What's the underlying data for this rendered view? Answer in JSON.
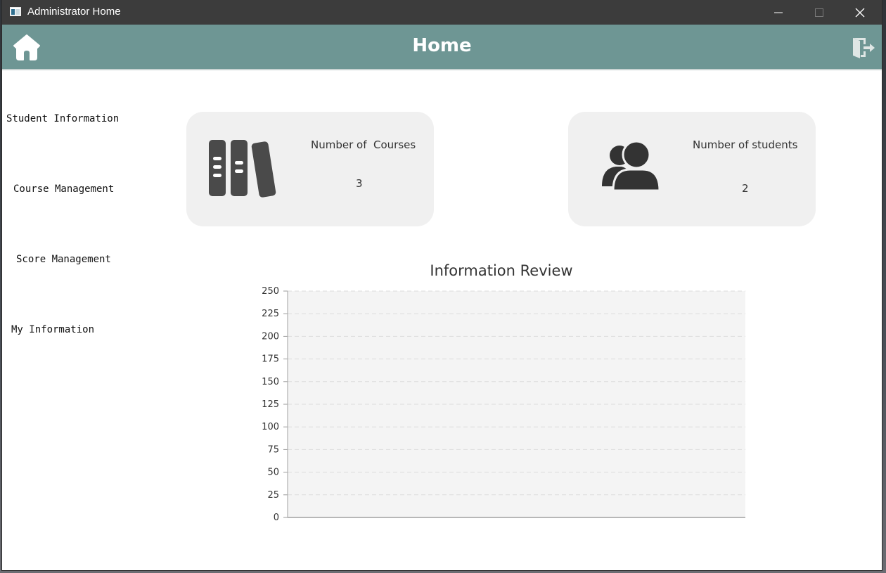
{
  "window": {
    "title": "Administrator Home"
  },
  "header": {
    "title": "Home",
    "home_icon": "home-icon",
    "logout_icon": "logout-door-icon",
    "background_color": "#6e9694"
  },
  "sidebar": {
    "items": [
      {
        "label": "Student Information"
      },
      {
        "label": "Course Management"
      },
      {
        "label": "Score Management"
      },
      {
        "label": "My Information"
      }
    ]
  },
  "cards": {
    "courses": {
      "label": "Number of  Courses",
      "value": "3",
      "icon": "books-icon"
    },
    "students": {
      "label": "Number of students",
      "value": "2",
      "icon": "users-icon"
    }
  },
  "chart_data": {
    "type": "bar",
    "title": "Information Review",
    "categories": [],
    "series": [],
    "ylim": [
      0,
      250
    ],
    "yticks": [
      "0",
      "25",
      "50",
      "75",
      "100",
      "125",
      "150",
      "175",
      "200",
      "225",
      "250"
    ],
    "grid": true
  }
}
